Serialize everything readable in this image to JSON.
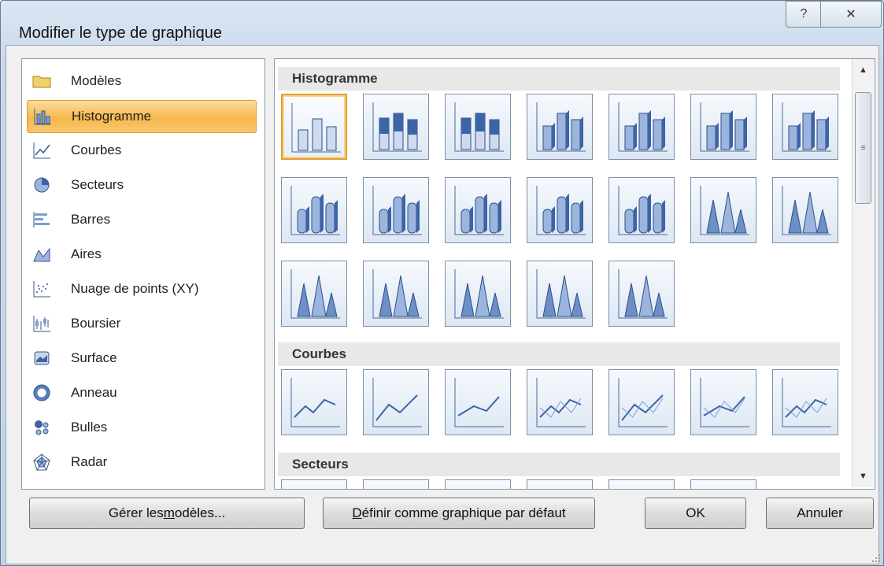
{
  "window": {
    "title": "Modifier le type de graphique",
    "help_glyph": "?",
    "close_glyph": "✕"
  },
  "left_panel": {
    "items": [
      {
        "label": "Modèles",
        "icon": "folder-icon",
        "selected": false
      },
      {
        "label": "Histogramme",
        "icon": "column-chart-icon",
        "selected": true
      },
      {
        "label": "Courbes",
        "icon": "line-chart-icon",
        "selected": false
      },
      {
        "label": "Secteurs",
        "icon": "pie-chart-icon",
        "selected": false
      },
      {
        "label": "Barres",
        "icon": "bar-chart-icon",
        "selected": false
      },
      {
        "label": "Aires",
        "icon": "area-chart-icon",
        "selected": false
      },
      {
        "label": "Nuage de points (XY)",
        "icon": "scatter-chart-icon",
        "selected": false
      },
      {
        "label": "Boursier",
        "icon": "stock-chart-icon",
        "selected": false
      },
      {
        "label": "Surface",
        "icon": "surface-chart-icon",
        "selected": false
      },
      {
        "label": "Anneau",
        "icon": "doughnut-chart-icon",
        "selected": false
      },
      {
        "label": "Bulles",
        "icon": "bubble-chart-icon",
        "selected": false
      },
      {
        "label": "Radar",
        "icon": "radar-chart-icon",
        "selected": false
      }
    ]
  },
  "gallery": {
    "sections": [
      {
        "title": "Histogramme",
        "thumb_count": 19,
        "selected_index": 0
      },
      {
        "title": "Courbes",
        "thumb_count": 7
      },
      {
        "title": "Secteurs",
        "thumb_count": 6
      }
    ]
  },
  "scrollbar": {
    "up": "▲",
    "down": "▼",
    "grip": "≡"
  },
  "buttons": {
    "manage_pre": "Gérer les ",
    "manage_accel": "m",
    "manage_post": "odèles...",
    "default_accel": "D",
    "default_post": "éfinir comme graphique par défaut",
    "ok": "OK",
    "cancel": "Annuler"
  },
  "colors": {
    "selection": "#f7b84c",
    "accent": "#5b7fbd"
  }
}
